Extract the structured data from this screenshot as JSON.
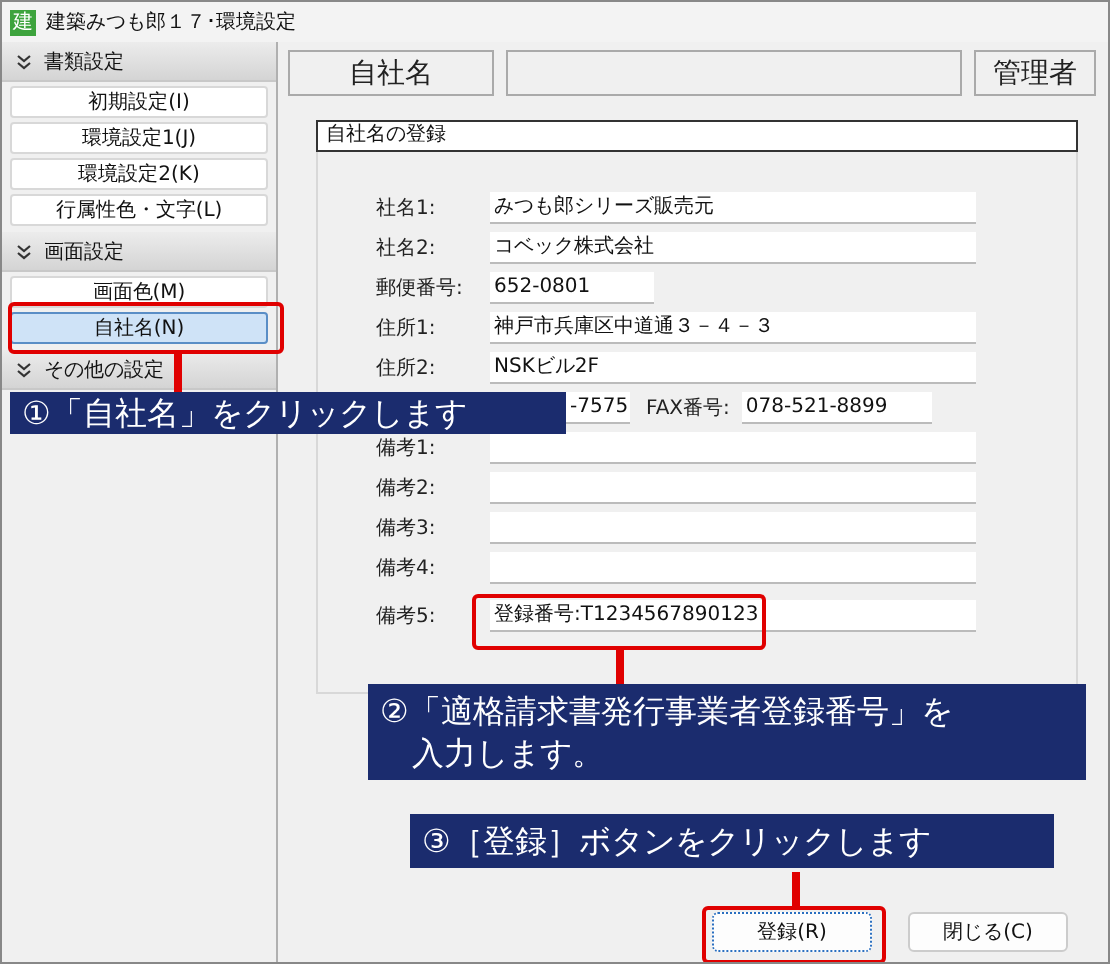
{
  "window": {
    "icon_glyph": "建",
    "title": "建築みつも郎１７･環境設定"
  },
  "sidebar": {
    "sections": [
      {
        "title": "書類設定",
        "items": [
          {
            "label": "初期設定(I)",
            "selected": false
          },
          {
            "label": "環境設定1(J)",
            "selected": false
          },
          {
            "label": "環境設定2(K)",
            "selected": false
          },
          {
            "label": "行属性色・文字(L)",
            "selected": false
          }
        ]
      },
      {
        "title": "画面設定",
        "items": [
          {
            "label": "画面色(M)",
            "selected": false
          },
          {
            "label": "自社名(N)",
            "selected": true
          }
        ]
      },
      {
        "title": "その他の設定"
      }
    ]
  },
  "header": {
    "page_label": "自社名",
    "user_label": "管理者"
  },
  "group": {
    "title": "自社名の登録",
    "rows": [
      {
        "kind": "full",
        "label": "社名1:",
        "value": "みつも郎シリーズ販売元"
      },
      {
        "kind": "full",
        "label": "社名2:",
        "value": "コベック株式会社"
      },
      {
        "kind": "short",
        "label": "郵便番号:",
        "value": "652-0801"
      },
      {
        "kind": "full",
        "label": "住所1:",
        "value": "神戸市兵庫区中道通３－４－３"
      },
      {
        "kind": "full",
        "label": "住所2:",
        "value": "NSKビル2F"
      },
      {
        "kind": "pair",
        "label": "",
        "value": "-7575",
        "label2": "FAX番号:",
        "value2": "078-521-8899"
      },
      {
        "kind": "full",
        "label": "備考1:",
        "value": ""
      },
      {
        "kind": "full",
        "label": "備考2:",
        "value": ""
      },
      {
        "kind": "full",
        "label": "備考3:",
        "value": ""
      },
      {
        "kind": "full",
        "label": "備考4:",
        "value": ""
      },
      {
        "kind": "full",
        "label": "備考5:",
        "value": "登録番号:T1234567890123"
      }
    ]
  },
  "buttons": [
    {
      "label": "登録(R)",
      "default": true
    },
    {
      "label": "閉じる(C)",
      "default": false
    }
  ],
  "callouts": [
    {
      "text": "①「自社名」をクリックします"
    },
    {
      "text": "②「適格請求書発行事業者登録番号」を入力します。"
    },
    {
      "text": "③［登録］ボタンをクリックします"
    }
  ]
}
